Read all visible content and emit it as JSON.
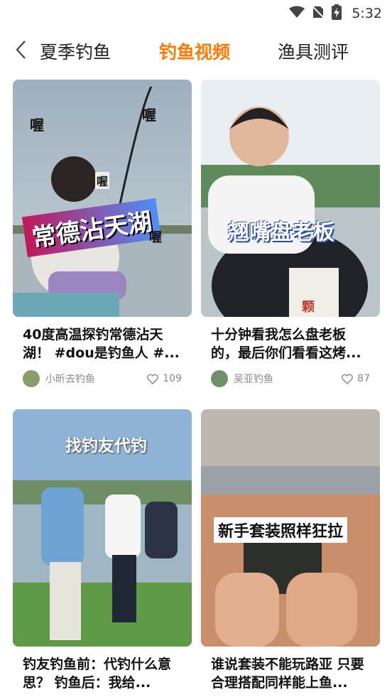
{
  "status": {
    "time": "5:32"
  },
  "tabs": [
    {
      "label": "夏季钓鱼"
    },
    {
      "label": "钓鱼视频"
    },
    {
      "label": "渔具测评"
    }
  ],
  "cards": [
    {
      "cover_text": "常德沾天湖",
      "cover_extra": [
        "喔",
        "喔",
        "喔",
        "喔"
      ],
      "title": "40度高温探钓常德沾天湖！ #dou是钓鱼人 #...",
      "author": "小昕去钓鱼",
      "likes": "109"
    },
    {
      "cover_text": "翘嘴盘老板",
      "cover_extra": [
        "颗"
      ],
      "title": "十分钟看我怎么盘老板的，最后你们看看这烤...",
      "author": "吴亚钓鱼",
      "likes": "87"
    },
    {
      "cover_text": "找钓友代钓",
      "title": "钓友钓鱼前：代钓什么意思？ 钓鱼后：我给..."
    },
    {
      "cover_text": "新手套装照样狂拉",
      "title": "谁说套装不能玩路亚 只要合理搭配同样能上鱼..."
    }
  ]
}
